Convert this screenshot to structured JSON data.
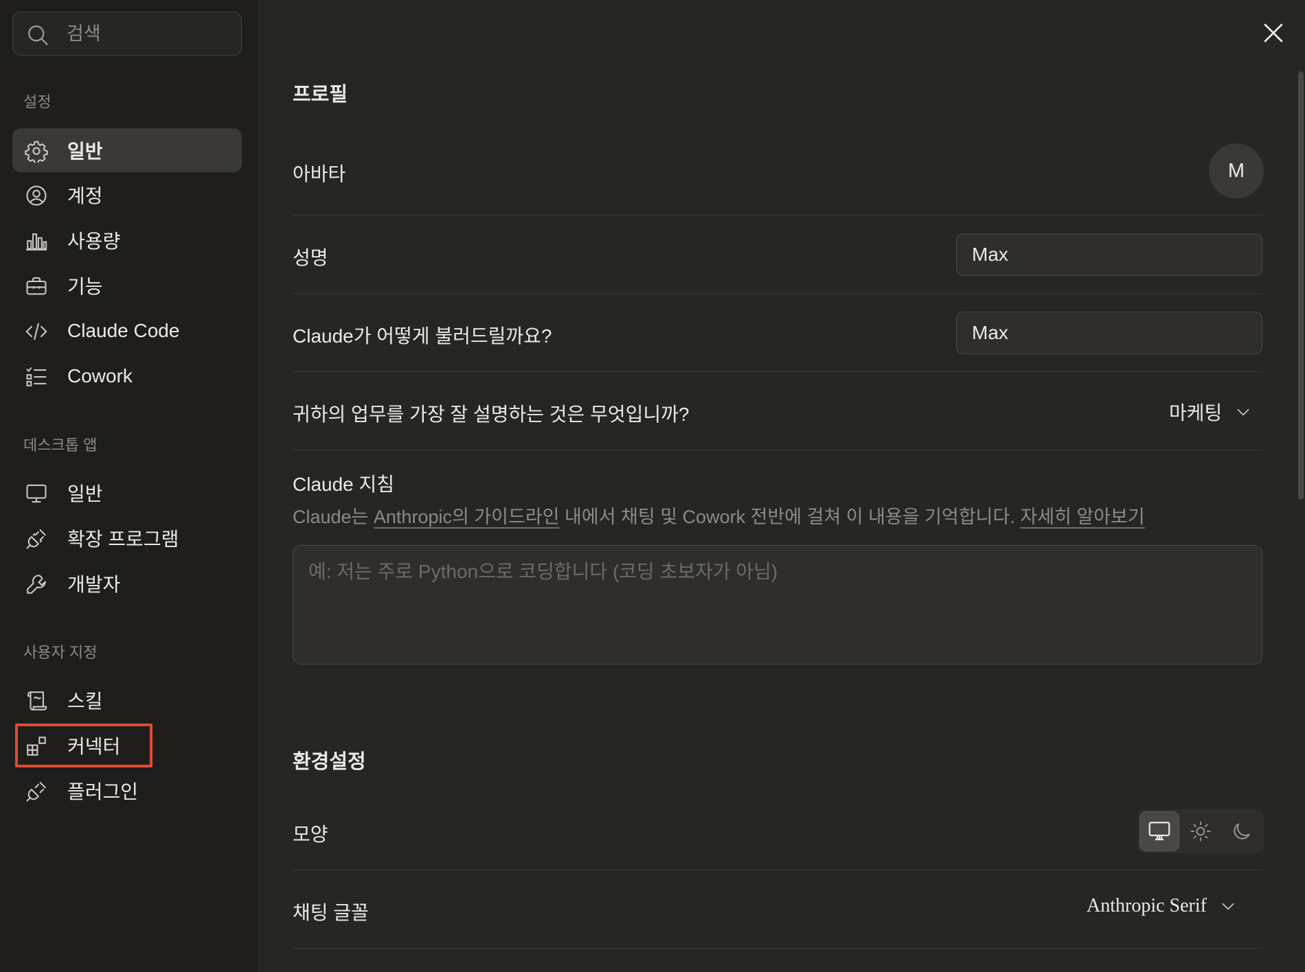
{
  "sidebar": {
    "search_placeholder": "검색",
    "sections": [
      {
        "label": "설정"
      },
      {
        "label": "데스크톱 앱"
      },
      {
        "label": "사용자 지정"
      }
    ],
    "settings_items": [
      {
        "label": "일반",
        "icon": "gear-icon",
        "active": true
      },
      {
        "label": "계정",
        "icon": "user-circle-icon"
      },
      {
        "label": "사용량",
        "icon": "bar-chart-icon"
      },
      {
        "label": "기능",
        "icon": "briefcase-icon"
      },
      {
        "label": "Claude Code",
        "icon": "code-icon"
      },
      {
        "label": "Cowork",
        "icon": "checklist-icon"
      }
    ],
    "desktop_items": [
      {
        "label": "일반",
        "icon": "monitor-icon"
      },
      {
        "label": "확장 프로그램",
        "icon": "plug-icon"
      },
      {
        "label": "개발자",
        "icon": "wrench-icon"
      }
    ],
    "custom_items": [
      {
        "label": "스킬",
        "icon": "scroll-icon"
      },
      {
        "label": "커넥터",
        "icon": "grid-plus-icon",
        "highlighted": true
      },
      {
        "label": "플러그인",
        "icon": "plug-icon"
      }
    ],
    "highlight_color": "#E04A32"
  },
  "profile": {
    "heading": "프로필",
    "avatar_label": "아바타",
    "avatar_initial": "M",
    "full_name_label": "성명",
    "full_name_value": "Max",
    "nickname_label": "Claude가 어떻게 불러드릴까요?",
    "nickname_value": "Max",
    "role_label": "귀하의 업무를 가장 잘 설명하는 것은 무엇입니까?",
    "role_value": "마케팅",
    "instructions_label": "Claude 지침",
    "instructions_help": {
      "part1": "Claude는 ",
      "link1": "Anthropic의 가이드라인",
      "part2": " 내에서 채팅 및 Cowork 전반에 걸쳐 이 내용을 기억합니다. ",
      "link2": "자세히 알아보기"
    },
    "instructions_placeholder": "예: 저는 주로 Python으로 코딩합니다 (코딩 초보자가 아님)"
  },
  "preferences": {
    "heading": "환경설정",
    "appearance_label": "모양",
    "appearance_options": [
      {
        "icon": "monitor-icon",
        "selected": true
      },
      {
        "icon": "sun-icon"
      },
      {
        "icon": "moon-icon"
      }
    ],
    "chat_font_label": "채팅 글꼴",
    "chat_font_value": "Anthropic Serif"
  }
}
